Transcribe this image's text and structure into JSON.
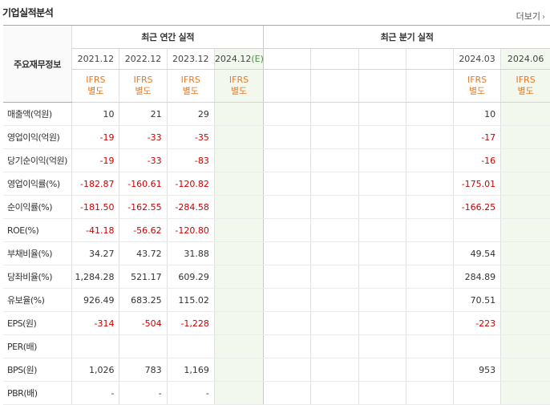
{
  "section": {
    "title": "기업실적분석",
    "more_label": "더보기",
    "more_icon": "chevron-right-icon"
  },
  "header": {
    "main_label": "주요재무정보",
    "annual_label": "최근 연간 실적",
    "quarter_label": "최근 분기 실적",
    "annual_years": [
      "2021.12",
      "2022.12",
      "2023.12",
      "2024.12"
    ],
    "estimate_mark": "(E)",
    "quarter_periods": [
      "2024.03",
      "2024.06"
    ],
    "ifrs_line1": "IFRS",
    "ifrs_line2": "별도"
  },
  "rows": [
    {
      "label": "매출액(억원)",
      "annual": [
        "10",
        "21",
        "29",
        ""
      ],
      "q1": "10",
      "q2": ""
    },
    {
      "label": "영업이익(억원)",
      "annual": [
        "-19",
        "-33",
        "-35",
        ""
      ],
      "q1": "-17",
      "q2": ""
    },
    {
      "label": "당기순이익(억원)",
      "annual": [
        "-19",
        "-33",
        "-83",
        ""
      ],
      "q1": "-16",
      "q2": ""
    },
    {
      "label": "영업이익률(%)",
      "annual": [
        "-182.87",
        "-160.61",
        "-120.82",
        ""
      ],
      "q1": "-175.01",
      "q2": ""
    },
    {
      "label": "순이익률(%)",
      "annual": [
        "-181.50",
        "-162.55",
        "-284.58",
        ""
      ],
      "q1": "-166.25",
      "q2": ""
    },
    {
      "label": "ROE(%)",
      "annual": [
        "-41.18",
        "-56.62",
        "-120.80",
        ""
      ],
      "q1": "",
      "q2": ""
    },
    {
      "label": "부채비율(%)",
      "annual": [
        "34.27",
        "43.72",
        "31.88",
        ""
      ],
      "q1": "49.54",
      "q2": ""
    },
    {
      "label": "당좌비율(%)",
      "annual": [
        "1,284.28",
        "521.17",
        "609.29",
        ""
      ],
      "q1": "284.89",
      "q2": ""
    },
    {
      "label": "유보율(%)",
      "annual": [
        "926.49",
        "683.25",
        "115.02",
        ""
      ],
      "q1": "70.51",
      "q2": ""
    },
    {
      "label": "EPS(원)",
      "annual": [
        "-314",
        "-504",
        "-1,228",
        ""
      ],
      "q1": "-223",
      "q2": ""
    },
    {
      "label": "PER(배)",
      "annual": [
        "",
        "",
        "",
        ""
      ],
      "q1": "",
      "q2": ""
    },
    {
      "label": "BPS(원)",
      "annual": [
        "1,026",
        "783",
        "1,169",
        ""
      ],
      "q1": "953",
      "q2": ""
    },
    {
      "label": "PBR(배)",
      "annual": [
        "-",
        "-",
        "-",
        ""
      ],
      "q1": "",
      "q2": ""
    }
  ],
  "colors": {
    "negative": "#cc0000",
    "ifrs": "#e57a27",
    "estimate_bg": "#f3f8ee",
    "estimate_text": "#3a9b2e"
  }
}
